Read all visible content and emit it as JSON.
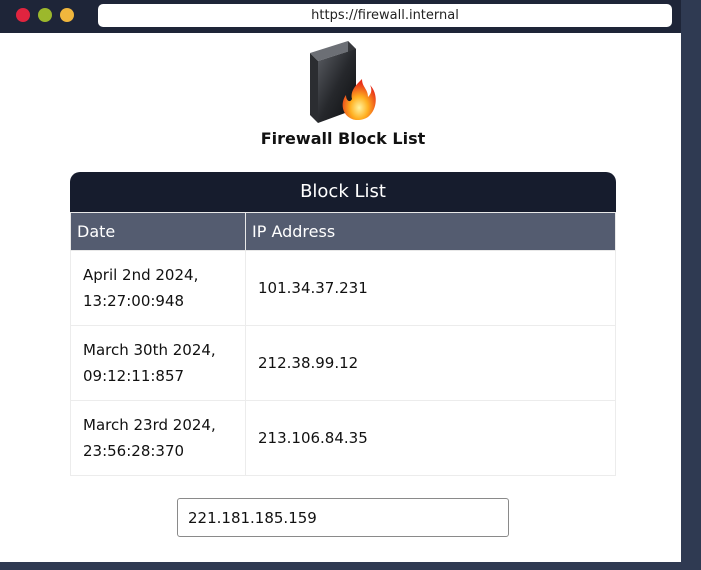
{
  "browser": {
    "url": "https://firewall.internal"
  },
  "app": {
    "title": "Firewall Block List",
    "logo_icon": "firewall-fire-icon"
  },
  "block_list": {
    "title": "Block List",
    "columns": [
      "Date",
      "IP Address"
    ],
    "rows": [
      {
        "date": "April 2nd 2024,\n13:27:00:948",
        "ip": "101.34.37.231"
      },
      {
        "date": "March 30th 2024,\n09:12:11:857",
        "ip": "212.38.99.12"
      },
      {
        "date": "March 23rd 2024,\n23:56:28:370",
        "ip": "213.106.84.35"
      }
    ]
  },
  "input": {
    "value": "221.181.185.159"
  },
  "colors": {
    "titlebar": "#1e2538",
    "table_header": "#161c2d",
    "column_header": "#545c70"
  }
}
